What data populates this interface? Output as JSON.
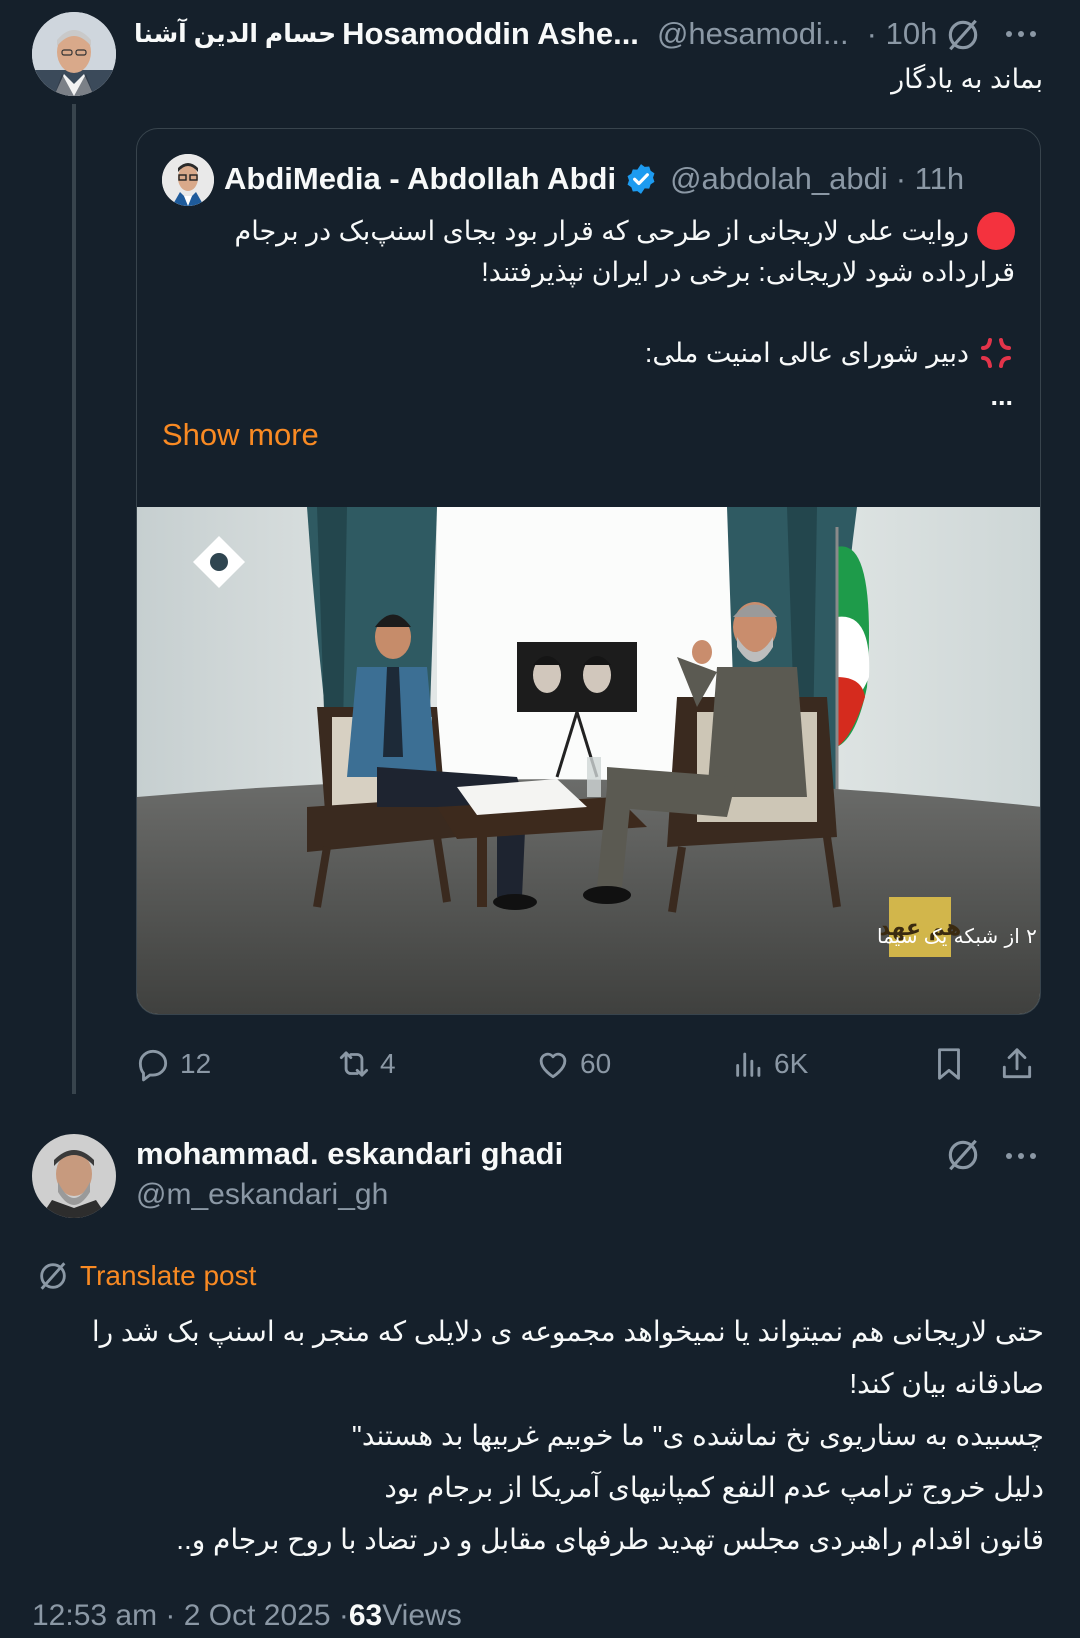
{
  "post1": {
    "author_fa": "حسام الدین آشنا",
    "author_en": "Hosamoddin Ashe...",
    "handle": "@hesamodi...",
    "time": "· 10h",
    "text": "بماند به یادگار",
    "quote": {
      "author": "AbdiMedia - Abdollah Abdi",
      "handle": "@abdolah_abdi",
      "time": "· 11h",
      "line1": "روایت علی لاریجانی از طرحی که قرار بود بجای اسنپ‌بک در برجام",
      "line2": "قرارداده شود لاریجانی: برخی در ایران نپذیرفتند!",
      "line3": "دبیر شورای عالی امنیت ملی:",
      "ellipsis": "...",
      "show_more": "Show more",
      "media_caption": "هم‌عهد | هر شب ساعت ۲۰ از شبکه یک سیما",
      "media_logo_text": "هم عهد"
    },
    "actions": {
      "replies": "12",
      "reposts": "4",
      "likes": "60",
      "views": "6K"
    }
  },
  "post2": {
    "author": "mohammad. eskandari ghadi",
    "handle": "@m_eskandari_gh",
    "translate": "Translate post",
    "lines": [
      "حتی لاریجانی هم نمیتواند یا نمیخواهد مجموعه ی دلایلی که منجر به اسنپ بک شد را",
      "صادقانه بیان کند!",
      "چسبیده به سناریوی نخ نماشده ی\" ما خوبیم غربیها بد هستند\"",
      "دلیل خروج ترامپ عدم النفع کمپانیهای آمریکا از برجام بود",
      "قانون اقدام راهبردی مجلس تهدید طرفهای مقابل و در تضاد با روح برجام و.."
    ],
    "meta_time": "12:53 am · 2 Oct 2025 · ",
    "meta_views_count": "63",
    "meta_views_label": " Views"
  },
  "colors": {
    "background": "#15202b",
    "text": "#f7f9f9",
    "muted": "#8b98a5",
    "accent": "#f98a23",
    "verified": "#1d9bf0",
    "border": "#38444d"
  },
  "icons": [
    "grok-icon",
    "more-icon",
    "verified-icon",
    "red-circle-emoji",
    "anger-emoji",
    "reply-icon",
    "repost-icon",
    "like-icon",
    "views-icon",
    "bookmark-icon",
    "share-icon",
    "translate-icon"
  ]
}
